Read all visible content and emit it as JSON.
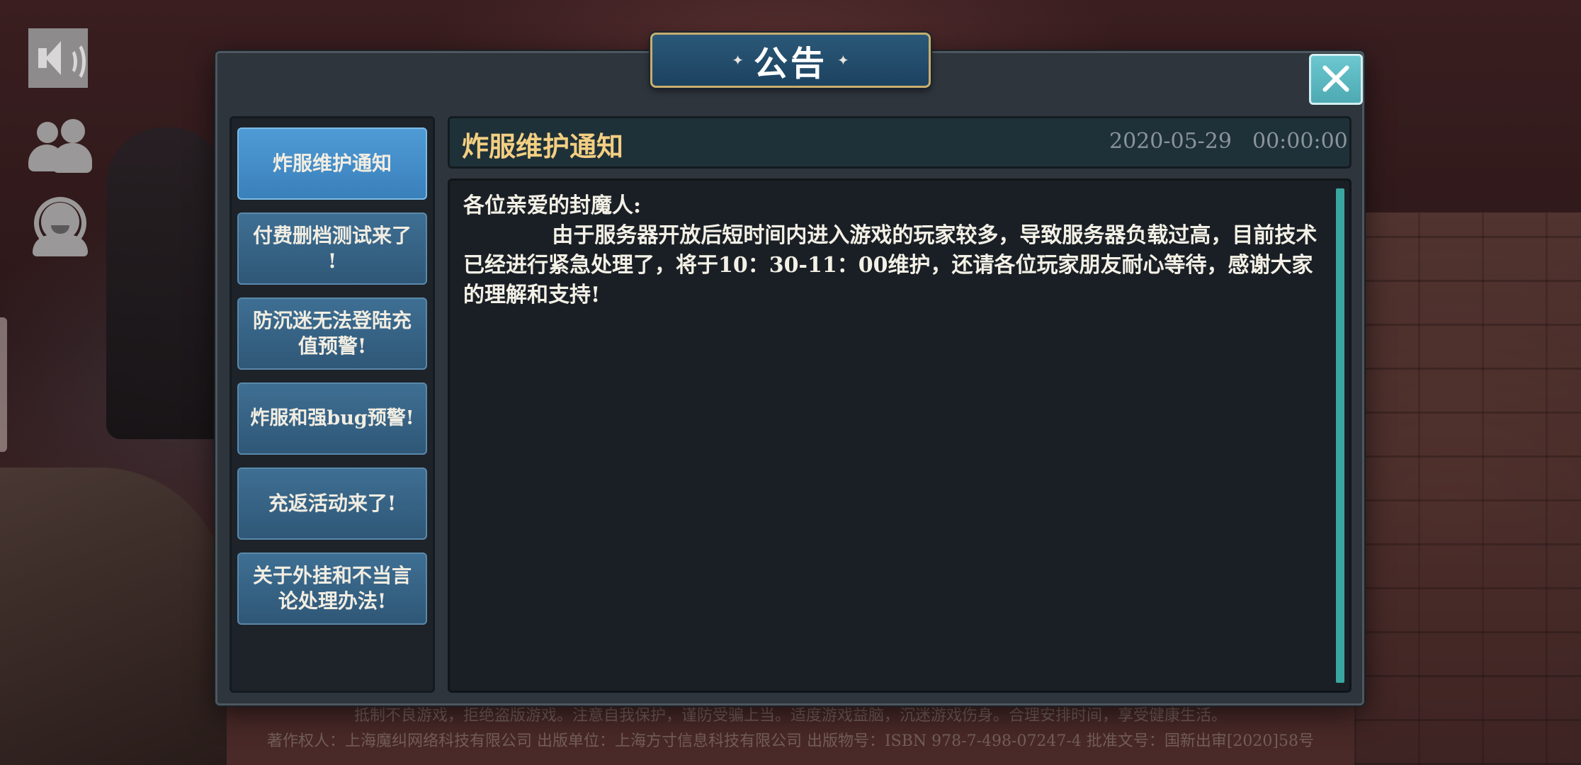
{
  "dialog": {
    "title": "公告",
    "title_ornament_left": "✦",
    "title_ornament_right": "✦"
  },
  "side_icons": [
    "speaker-icon",
    "friends-icon",
    "customer-service-icon"
  ],
  "tabs": [
    {
      "label": "炸服维护通知",
      "active": true
    },
    {
      "label": "付费删档测试来了\n!",
      "active": false
    },
    {
      "label": "防沉迷无法登陆充\n值预警!",
      "active": false
    },
    {
      "label": "炸服和强bug预警!",
      "active": false
    },
    {
      "label": "充返活动来了!",
      "active": false
    },
    {
      "label": "关于外挂和不当言\n论处理办法!",
      "active": false
    }
  ],
  "announcement": {
    "title": "炸服维护通知",
    "date": "2020-05-29",
    "time": "00:00:00",
    "body": "各位亲爱的封魔人:\n            由于服务器开放后短时间内进入游戏的玩家较多，导致服务器负载过高，目前技术已经进行紧急处理了，将于10：30-11：00维护，还请各位玩家朋友耐心等待，感谢大家的理解和支持!"
  },
  "legal": {
    "line1": "抵制不良游戏，拒绝盗版游戏。注意自我保护，谨防受骗上当。适度游戏益脑，沉迷游戏伤身。合理安排时间，享受健康生活。",
    "line2": "著作权人：上海魔纠网络科技有限公司    出版单位：上海方寸信息科技有限公司    出版物号：ISBN  978-7-498-07247-4    批准文号：国新出审[2020]58号"
  },
  "colors": {
    "accent_active_tab": "#4f9bd6",
    "tab": "#3e6f93",
    "title_gold": "#f3cf82",
    "scrollbar": "#3aa6a0",
    "close_button": "#6cc8d0"
  }
}
